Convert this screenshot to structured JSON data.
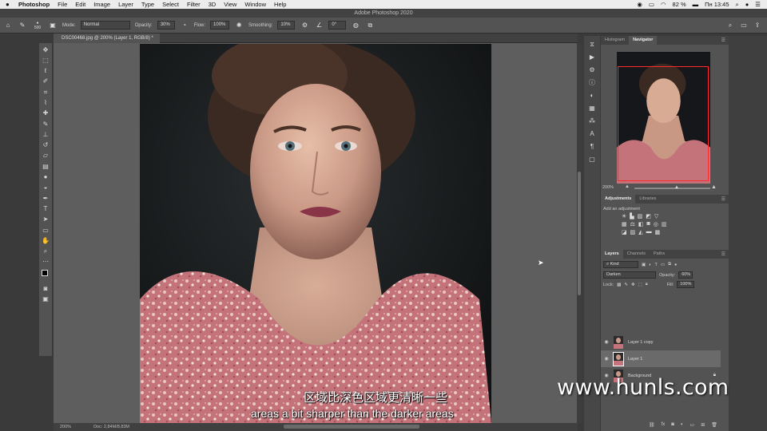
{
  "menubar": {
    "app": "Photoshop",
    "items": [
      "File",
      "Edit",
      "Image",
      "Layer",
      "Type",
      "Select",
      "Filter",
      "3D",
      "View",
      "Window",
      "Help"
    ],
    "battery": "82 %",
    "clock": "Пн 13:45"
  },
  "window": {
    "title": "Adobe Photoshop 2020"
  },
  "options": {
    "brush_size": "500",
    "mode_label": "Mode:",
    "mode_value": "Normal",
    "opacity_label": "Opacity:",
    "opacity_value": "30%",
    "flow_label": "Flow:",
    "flow_value": "100%",
    "smoothing_label": "Smoothing:",
    "smoothing_value": "10%",
    "angle_value": "0°"
  },
  "document": {
    "tab_title": "DSC00468.jpg @ 200% (Layer 1, RGB/8) *",
    "zoom": "200%",
    "doc_info": "Doc: 2,84M/8,83M"
  },
  "navigator": {
    "tabs": [
      "Histogram",
      "Navigator"
    ],
    "active": "Navigator",
    "zoom": "200%"
  },
  "adjustments": {
    "tabs": [
      "Adjustments",
      "Libraries"
    ],
    "hint": "Add an adjustment"
  },
  "layers": {
    "tabs": [
      "Layers",
      "Channels",
      "Paths"
    ],
    "filter_kind": "Kind",
    "blend_mode": "Darken",
    "opacity_label": "Opacity:",
    "opacity_value": "60%",
    "lock_label": "Lock:",
    "fill_label": "Fill:",
    "fill_value": "100%",
    "items": [
      {
        "name": "Layer 1 copy"
      },
      {
        "name": "Layer 1"
      },
      {
        "name": "Background"
      }
    ]
  },
  "subtitles": {
    "chinese": "区域比深色区域更清晰一些",
    "english": "areas a bit sharper than the darker areas"
  },
  "watermark": "www.hunls.com",
  "colors": {
    "layer_selected": "#6a6a6a",
    "navigator_frame": "#ff2b2b"
  }
}
